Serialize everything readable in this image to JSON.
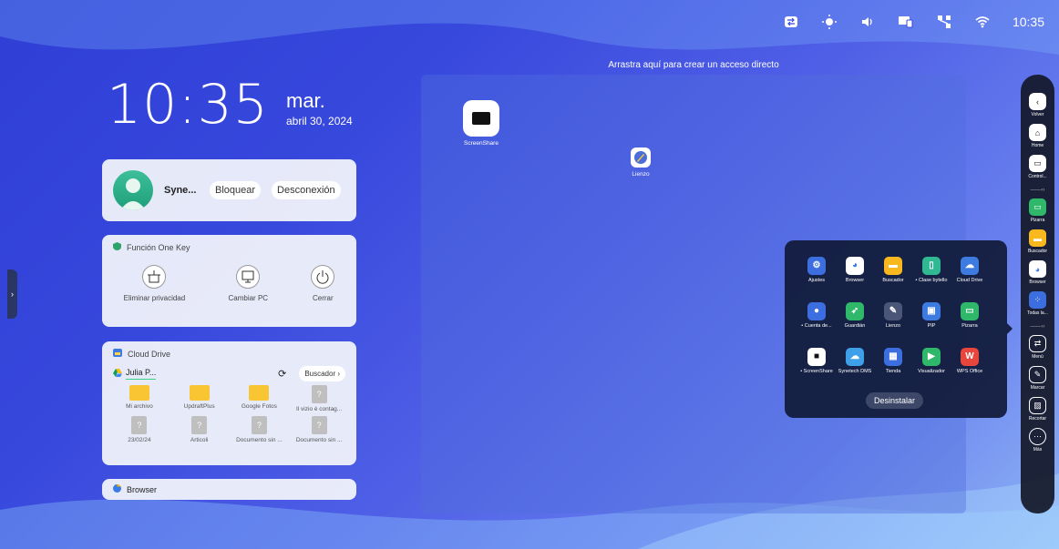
{
  "status_bar": {
    "time": "10:35"
  },
  "clock": {
    "time": "10:35",
    "weekday": "mar.",
    "date": "abril 30, 2024"
  },
  "user_card": {
    "name": "Syne...",
    "lock_label": "Bloquear",
    "logout_label": "Desconexión"
  },
  "one_key": {
    "title": "Función One Key",
    "items": [
      "Eliminar privacidad",
      "Cambiar PC",
      "Cerrar"
    ]
  },
  "cloud_drive": {
    "title": "Cloud Drive",
    "account": "Julia P...",
    "search_label": "Buscador",
    "files": [
      "Mi archivo",
      "UpdraftPlus",
      "Google Fotos",
      "Il vizio è contag...",
      "23/02/24",
      "Articoli",
      "Documento sin ...",
      "Documento sin ..."
    ]
  },
  "browser_card": {
    "title": "Browser"
  },
  "desktop": {
    "hint": "Arrastra aquí para crear un acceso directo",
    "icons": [
      "ScreenShare",
      "Lienzo"
    ]
  },
  "app_panel": {
    "apps": [
      "Ajustes",
      "Browser",
      "Buscador",
      "• Clase bytello",
      "Cloud Drive",
      "• Cuenta de...",
      "Guardián",
      "Lienzo",
      "PIP",
      "Pizarra",
      "• ScreenShare",
      "Synetech DMS",
      "Tienda",
      "Visualizador",
      "WPS Office"
    ],
    "uninstall_label": "Desinstalar"
  },
  "sidebar": {
    "items": [
      "Volver",
      "Home",
      "Control...",
      "Pizarra",
      "Buscador",
      "Browser",
      "Todas la...",
      "Menú",
      "Marcar",
      "Recortar",
      "Más"
    ]
  },
  "colors": {
    "background": "#3748dd",
    "panel": "#121c3c",
    "folder": "#f9c532"
  }
}
